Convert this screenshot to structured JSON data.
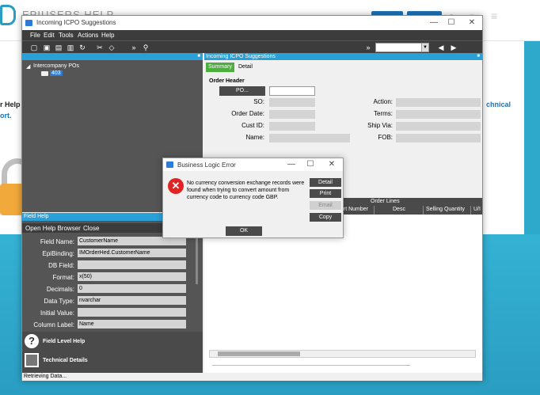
{
  "site": {
    "logo_text": "EPIUSERS HELP",
    "left_text_1": "r Help",
    "left_text_2": "ort.",
    "right_text": "chnical"
  },
  "window": {
    "title": "Incoming ICPO Suggestions",
    "min": "—",
    "max": "☐",
    "close": "✕"
  },
  "menu": [
    "File",
    "Edit",
    "Tools",
    "Actions",
    "Help"
  ],
  "toolbar_icons": [
    "new-icon",
    "save-icon",
    "print-icon",
    "delete-icon",
    "refresh-icon",
    "cut-icon",
    "clear-icon",
    "overflow-icon",
    "search-icon"
  ],
  "toolbar_right": {
    "overflow": "»",
    "back": "◀",
    "forward": "▶",
    "overflow2": "»"
  },
  "tree": {
    "header": "",
    "root": "Intercompany POs",
    "node": "403"
  },
  "field_help": {
    "header": "Field Help",
    "tabs": [
      "Open Help Browser",
      "Close"
    ],
    "rows": [
      {
        "label": "Field Name:",
        "value": "CustomerName"
      },
      {
        "label": "EpiBinding:",
        "value": "IMOrderHed.CustomerName"
      },
      {
        "label": "DB Field:",
        "value": ""
      },
      {
        "label": "Format:",
        "value": "x(50)"
      },
      {
        "label": "Decimals:",
        "value": "0"
      },
      {
        "label": "Data Type:",
        "value": "nvarchar"
      },
      {
        "label": "Initial Value:",
        "value": ""
      },
      {
        "label": "Column Label:",
        "value": "Name"
      }
    ],
    "links": [
      "Field Level Help",
      "Technical Details"
    ]
  },
  "status": "Retrieving Data...",
  "form": {
    "header": "Incoming ICPO Suggestions",
    "tabs": [
      "Summary",
      "Detail"
    ],
    "order_header": "Order Header",
    "po_button": "PO...",
    "left_labels": [
      "SO:",
      "Order Date:",
      "Cust ID:",
      "Name:"
    ],
    "right_labels": [
      "Action:",
      "Terms:",
      "Ship Via:",
      "FOB:"
    ],
    "grid_title": "Order Lines",
    "columns": [
      "art Number",
      "Desc",
      "Selling Quantity",
      "U/I"
    ]
  },
  "dialog": {
    "title": "Business Logic Error",
    "message": "No currency conversion exchange records were found when trying to convert amount from currency code  to currency code GBP.",
    "buttons": [
      "Detail",
      "Print",
      "Email",
      "Copy"
    ],
    "ok": "OK"
  }
}
